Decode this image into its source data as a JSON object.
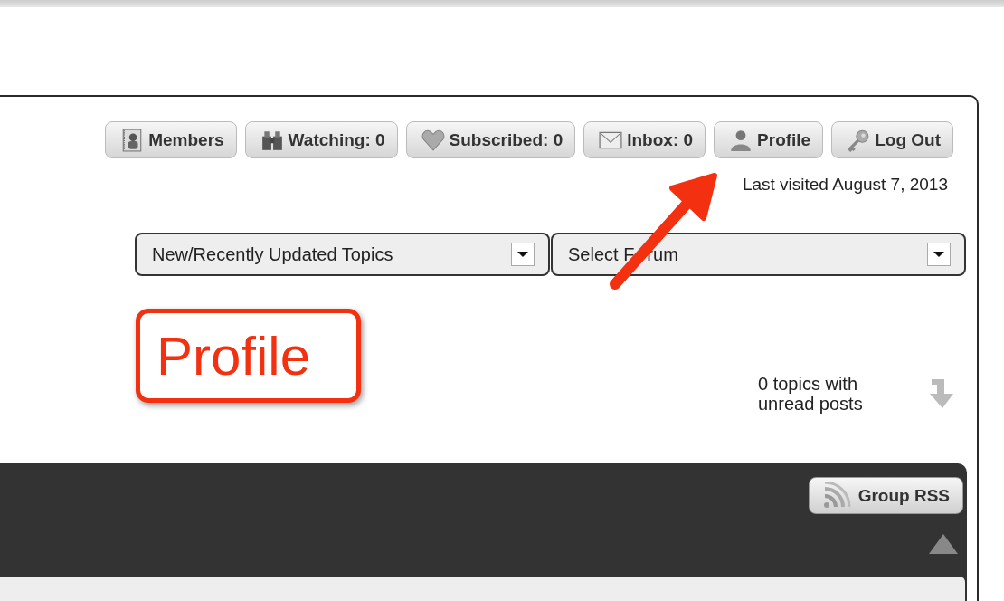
{
  "toolbar": {
    "buttons": [
      {
        "kind": "members",
        "label": "Members"
      },
      {
        "kind": "watching",
        "label": "Watching: 0"
      },
      {
        "kind": "subscribed",
        "label": "Subscribed: 0"
      },
      {
        "kind": "inbox",
        "label": "Inbox: 0"
      },
      {
        "kind": "profile",
        "label": "Profile"
      },
      {
        "kind": "logout",
        "label": "Log Out"
      }
    ]
  },
  "last_visited": "Last visited August 7, 2013",
  "dropdowns": [
    {
      "value": "New/Recently Updated Topics"
    },
    {
      "value": "Select F",
      "value_after_arrow": "rum"
    }
  ],
  "unread": {
    "text": "0 topics with unread posts"
  },
  "group_bar": {
    "rss_button": "Group RSS"
  },
  "annotation": {
    "label": "Profile"
  }
}
